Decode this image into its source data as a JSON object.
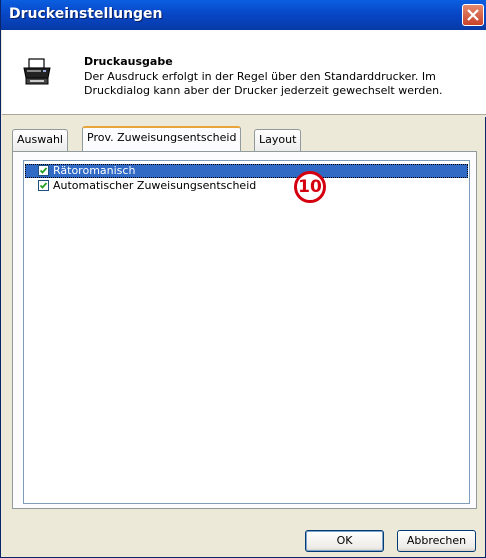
{
  "window": {
    "title": "Druckeinstellungen"
  },
  "header": {
    "title": "Druckausgabe",
    "description": "Der Ausdruck erfolgt in der Regel über den Standarddrucker. Im Druckdialog kann aber der Drucker jederzeit gewechselt werden."
  },
  "tabs": [
    {
      "label": "Auswahl",
      "active": false
    },
    {
      "label": "Prov. Zuweisungsentscheid",
      "active": true
    },
    {
      "label": "Layout",
      "active": false
    }
  ],
  "list": {
    "items": [
      {
        "label": "Rätoromanisch",
        "checked": true,
        "selected": true
      },
      {
        "label": "Automatischer Zuweisungsentscheid",
        "checked": true,
        "selected": false
      }
    ]
  },
  "callout": {
    "label": "10"
  },
  "buttons": {
    "ok": "OK",
    "cancel": "Abbrechen"
  },
  "colors": {
    "title_bar": "#0847c8",
    "selection": "#316ac5",
    "callout": "#d4000f",
    "tab_highlight": "#e8a53c"
  }
}
